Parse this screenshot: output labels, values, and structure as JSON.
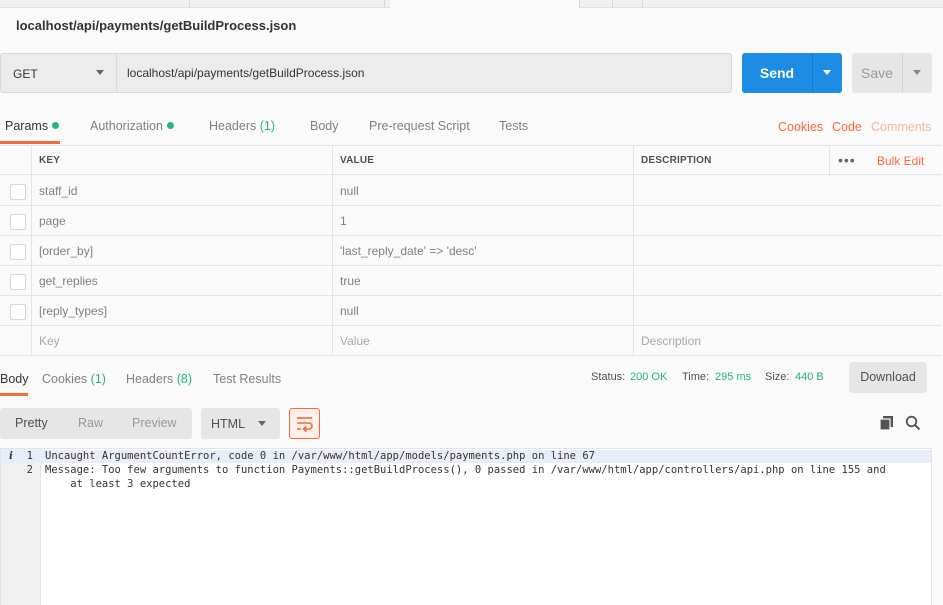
{
  "request": {
    "title": "localhost/api/payments/getBuildProcess.json",
    "method": "GET",
    "url": "localhost/api/payments/getBuildProcess.json",
    "send_label": "Send",
    "save_label": "Save"
  },
  "request_tabs": {
    "params": "Params",
    "authorization": "Authorization",
    "headers": "Headers",
    "headers_count": "(1)",
    "body": "Body",
    "prerequest": "Pre-request Script",
    "tests": "Tests",
    "cookies": "Cookies",
    "code": "Code",
    "comments": "Comments"
  },
  "params_table": {
    "headers": [
      "KEY",
      "VALUE",
      "DESCRIPTION"
    ],
    "bulk_edit": "Bulk Edit",
    "more": "•••",
    "rows": [
      {
        "key": "staff_id",
        "value": "null",
        "description": ""
      },
      {
        "key": "page",
        "value": "1",
        "description": ""
      },
      {
        "key": "[order_by]",
        "value": "'last_reply_date' => 'desc'",
        "description": ""
      },
      {
        "key": "get_replies",
        "value": "true",
        "description": ""
      },
      {
        "key": "[reply_types]",
        "value": "null",
        "description": ""
      }
    ],
    "placeholder": {
      "key": "Key",
      "value": "Value",
      "description": "Description"
    }
  },
  "response_tabs": {
    "body": "Body",
    "cookies": "Cookies",
    "cookies_count": "(1)",
    "headers": "Headers",
    "headers_count": "(8)",
    "test_results": "Test Results"
  },
  "status": {
    "status_label": "Status:",
    "status_value": "200 OK",
    "time_label": "Time:",
    "time_value": "295 ms",
    "size_label": "Size:",
    "size_value": "440 B",
    "download": "Download"
  },
  "viewer": {
    "pretty": "Pretty",
    "raw": "Raw",
    "preview": "Preview",
    "format": "HTML"
  },
  "response_body": {
    "lines": [
      {
        "n": "1",
        "text": "Uncaught ArgumentCountError, code 0 in /var/www/html/app/models/payments.php on line 67"
      },
      {
        "n": "2",
        "text": "Message: Too few arguments to function Payments::getBuildProcess(), 0 passed in /var/www/html/app/controllers/api.php on line 155 and"
      },
      {
        "n": "",
        "text": "    at least 3 expected"
      }
    ],
    "info_marker": "i"
  },
  "colors": {
    "accent": "#f26b3a",
    "primary": "#1c8ce4",
    "success": "#26b47f"
  }
}
